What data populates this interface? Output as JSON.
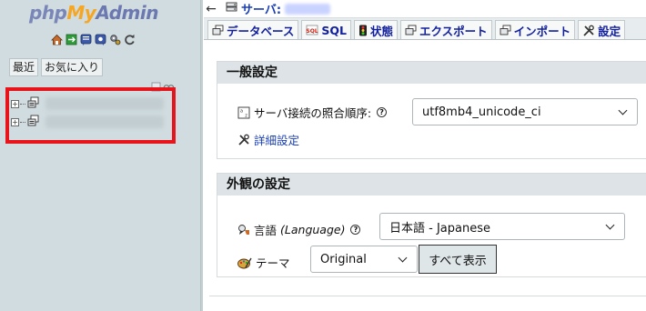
{
  "logo": {
    "php": "php",
    "my": "My",
    "admin": "Admin"
  },
  "nav": {
    "tabs": [
      "最近",
      "お気に入り"
    ],
    "icons": [
      "home-icon",
      "logout-icon",
      "docs-icon",
      "sql-docs-icon",
      "settings-icon",
      "reload-icon"
    ],
    "databases": [
      {
        "expander": "+",
        "name": ""
      },
      {
        "expander": "+",
        "name": ""
      }
    ]
  },
  "topbar": {
    "back": "←",
    "server_label": "サーバ:"
  },
  "tabs": [
    {
      "label": "データベース",
      "icon": "database-icon"
    },
    {
      "label": "SQL",
      "icon": "sql-icon"
    },
    {
      "label": "状態",
      "icon": "status-icon"
    },
    {
      "label": "エクスポート",
      "icon": "export-icon"
    },
    {
      "label": "インポート",
      "icon": "import-icon"
    },
    {
      "label": "設定",
      "icon": "settings-icon"
    }
  ],
  "general": {
    "title": "一般設定",
    "collation_label": "サーバ接続の照合順序:",
    "collation_value": "utf8mb4_unicode_ci",
    "help": "?",
    "advanced_link": "詳細設定"
  },
  "appearance": {
    "title": "外観の設定",
    "language_label": "言語",
    "language_sub": "(Language)",
    "language_value": "日本語 - Japanese",
    "theme_label": "テーマ",
    "theme_value": "Original",
    "show_all_button": "すべて表示",
    "help": "?"
  },
  "colors": {
    "highlight": "#e8141c",
    "nav_bg": "#d0dce0",
    "link": "#1a3fb5"
  }
}
